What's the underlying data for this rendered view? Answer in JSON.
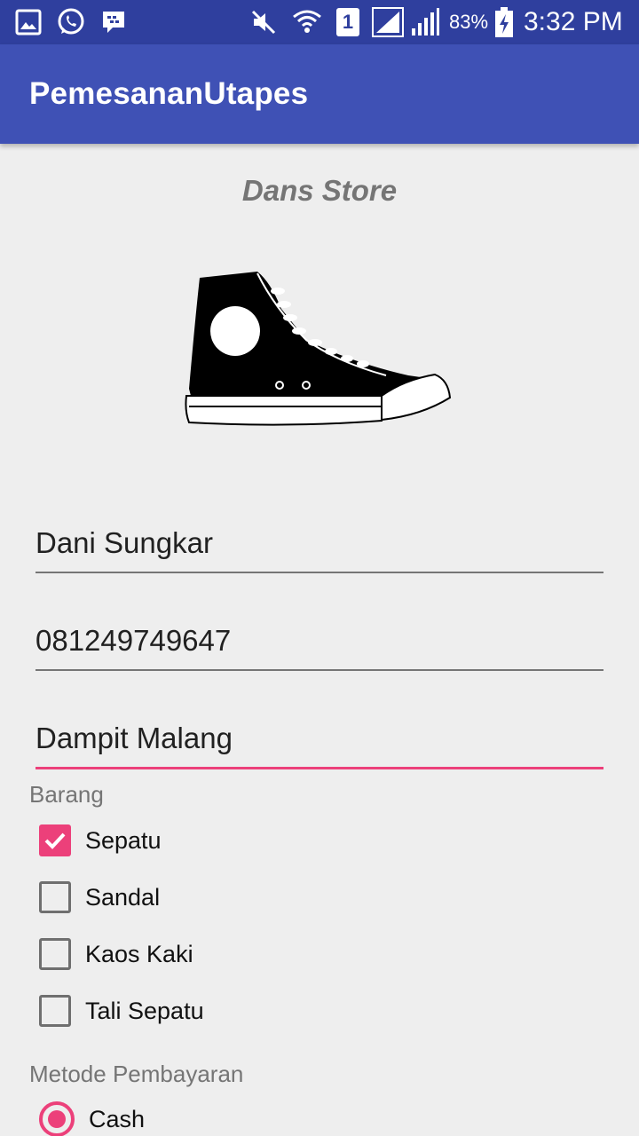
{
  "status_bar": {
    "battery_percent": "83%",
    "time": "3:32 PM",
    "sim_label": "1",
    "icons": [
      "gallery-icon",
      "whatsapp-icon",
      "bbm-icon",
      "mute-icon",
      "wifi-icon",
      "sim-icon",
      "signal-icon",
      "signal-icon-2",
      "battery-charging-icon"
    ]
  },
  "app_bar": {
    "title": "PemesananUtapes"
  },
  "store": {
    "name": "Dans Store"
  },
  "form": {
    "name_value": "Dani Sungkar",
    "phone_value": "081249749647",
    "address_value": "Dampit Malang"
  },
  "items_section": {
    "label": "Barang",
    "options": [
      {
        "label": "Sepatu",
        "checked": true
      },
      {
        "label": "Sandal",
        "checked": false
      },
      {
        "label": "Kaos Kaki",
        "checked": false
      },
      {
        "label": "Tali Sepatu",
        "checked": false
      }
    ]
  },
  "payment_section": {
    "label": "Metode Pembayaran",
    "options": [
      {
        "label": "Cash",
        "selected": true
      }
    ]
  },
  "colors": {
    "primary": "#3f51b5",
    "primary_dark": "#2f3f9e",
    "accent": "#ec407a",
    "background": "#eeeeee"
  }
}
